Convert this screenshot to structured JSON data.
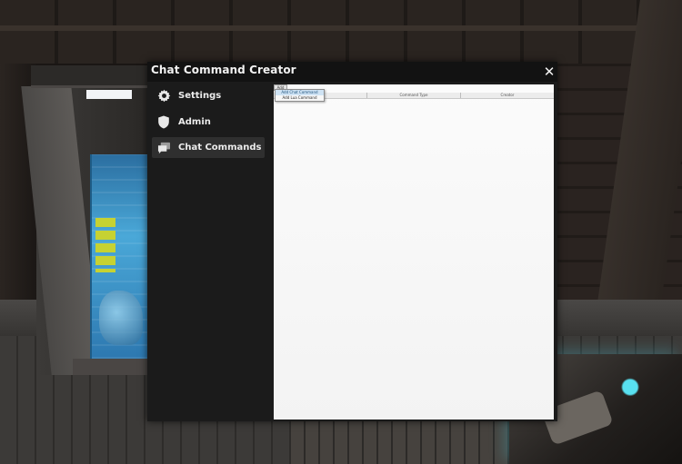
{
  "window": {
    "title": "Chat Command Creator",
    "close_label": "✕"
  },
  "sidebar": {
    "items": [
      {
        "label": "Settings",
        "icon": "gear-icon",
        "active": false
      },
      {
        "label": "Admin",
        "icon": "shield-icon",
        "active": false
      },
      {
        "label": "Chat Commands",
        "icon": "chat-bubble-icon",
        "active": true
      }
    ]
  },
  "content": {
    "add_button_label": "Add",
    "columns": [
      "",
      "Command Type",
      "Creator"
    ],
    "menu": {
      "items": [
        "Add Chat Command",
        "Add Lua Command"
      ],
      "hovered_index": 0
    }
  },
  "colors": {
    "dialog_bg": "#1b1b1b",
    "title_bar": "#121212",
    "active_item": "#2f2f2f",
    "panel_bg": "#f7f7f7",
    "menu_hover": "#cfe3f4"
  }
}
